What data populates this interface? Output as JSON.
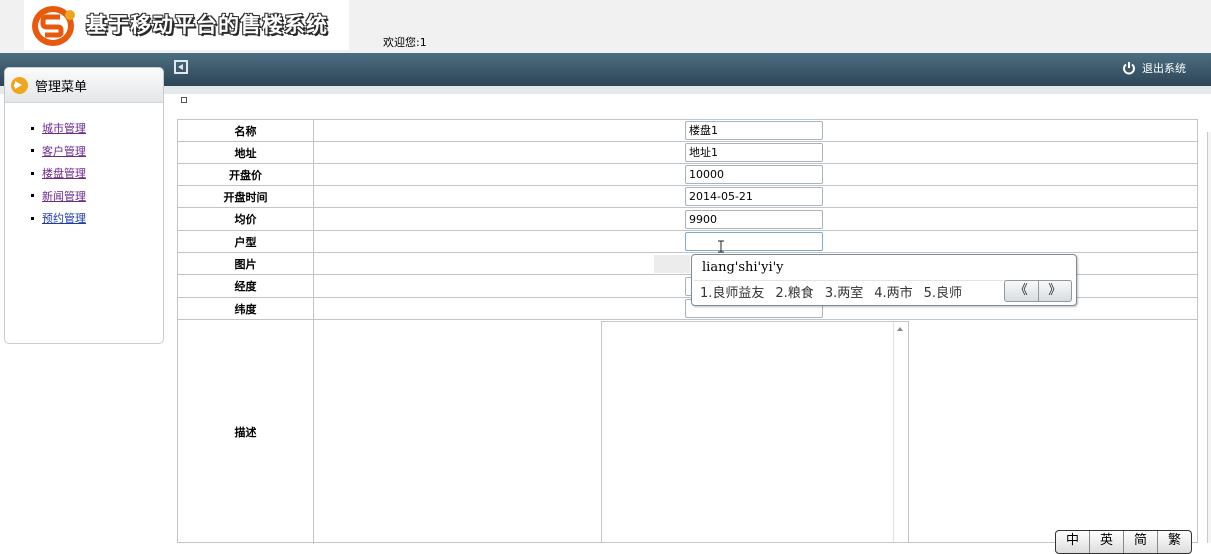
{
  "header": {
    "title": "基于移动平台的售楼系统",
    "welcome": "欢迎您:1",
    "logout_label": "退出系统"
  },
  "sidebar": {
    "title": "管理菜单",
    "items": [
      {
        "label": "城市管理"
      },
      {
        "label": "客户管理"
      },
      {
        "label": "楼盘管理"
      },
      {
        "label": "新闻管理"
      },
      {
        "label": "预约管理"
      }
    ]
  },
  "form": {
    "fields": [
      {
        "label": "名称",
        "value": "楼盘1"
      },
      {
        "label": "地址",
        "value": "地址1"
      },
      {
        "label": "开盘价",
        "value": "10000"
      },
      {
        "label": "开盘时间",
        "value": "2014-05-21"
      },
      {
        "label": "均价",
        "value": "9900"
      },
      {
        "label": "户型",
        "value": ""
      },
      {
        "label": "图片",
        "value": ""
      },
      {
        "label": "经度",
        "value": ""
      },
      {
        "label": "纬度",
        "value": ""
      },
      {
        "label": "描述",
        "value": ""
      }
    ]
  },
  "ime": {
    "input": "liang'shi'yi'y",
    "candidates": [
      "1.良师益友",
      "2.粮食",
      "3.两室",
      "4.两市",
      "5.良师"
    ],
    "prev": "《",
    "next": "》",
    "toolbar": [
      "中",
      "英",
      "简",
      "繁"
    ]
  },
  "colors": {
    "header_bar": "#2c4556",
    "link": "#1e3aa8",
    "visited_link": "#6a2a8a",
    "logo_orange": "#f0a51f"
  }
}
